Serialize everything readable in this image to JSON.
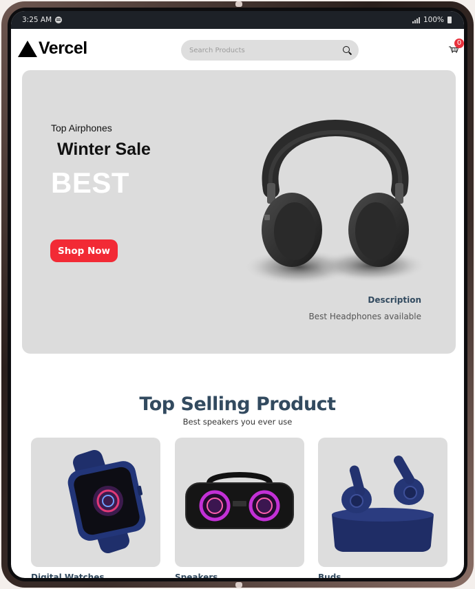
{
  "status_bar": {
    "time": "3:25 AM",
    "battery": "100%"
  },
  "header": {
    "logo_text": "Vercel",
    "search_placeholder": "Search Products",
    "cart_count": "0"
  },
  "hero": {
    "small_heading": "Top Airphones",
    "mid_heading": "Winter Sale",
    "big_heading": "BEST",
    "button_label": "Shop Now",
    "description_title": "Description",
    "description_text": "Best Headphones available"
  },
  "top_selling": {
    "title": "Top Selling Product",
    "subtitle": "Best speakers you ever use",
    "products": [
      {
        "name": "Digital Watches",
        "icon": "smartwatch-image"
      },
      {
        "name": "Speakers",
        "icon": "speaker-image"
      },
      {
        "name": "Buds",
        "icon": "earbuds-image"
      }
    ]
  },
  "colors": {
    "accent_red": "#f22a35",
    "heading_blue": "#324a5f",
    "card_grey": "#dddddd"
  }
}
